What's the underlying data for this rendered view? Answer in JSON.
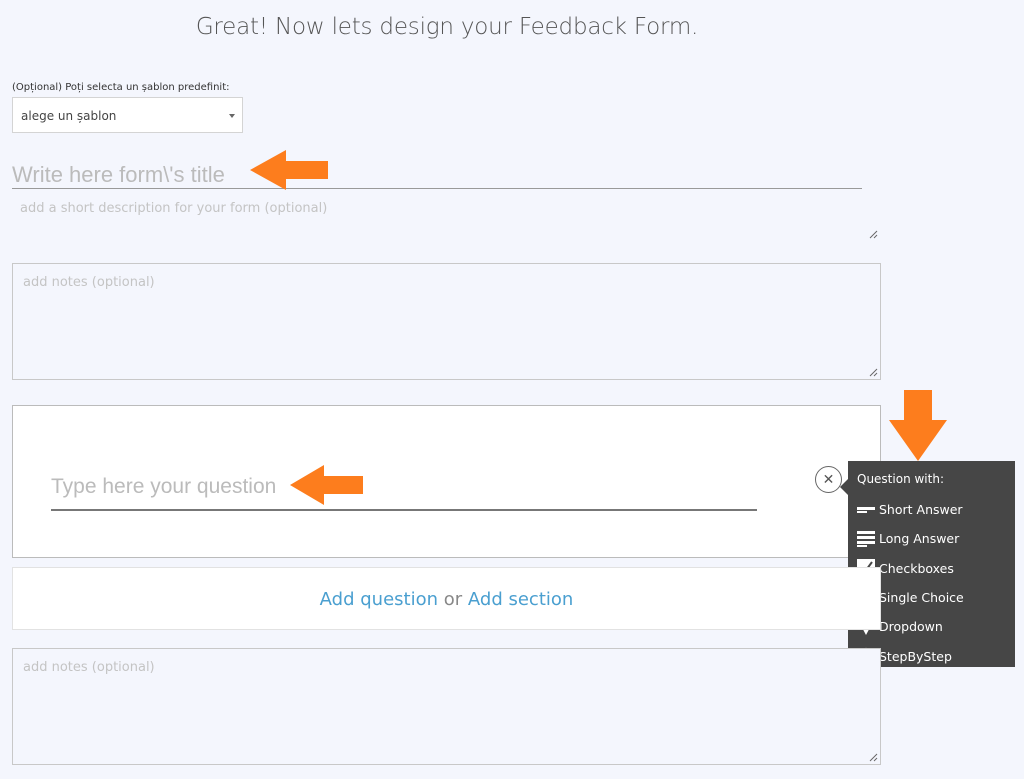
{
  "heading": "Great! Now lets design your Feedback Form.",
  "template": {
    "label": "(Opțional) Poți selecta un șablon predefinit:",
    "selected": "alege un șablon"
  },
  "form": {
    "title_placeholder": "Write here form\\'s title",
    "description_placeholder": "add a short description for your form (optional)",
    "notes_top_placeholder": "add notes (optional)",
    "notes_bottom_placeholder": "add notes (optional)"
  },
  "question": {
    "placeholder": "Type here your question",
    "close_symbol": "✕"
  },
  "add_bar": {
    "add_question": "Add question",
    "or": "or",
    "add_section": "Add section"
  },
  "question_type_menu": {
    "heading": "Question with:",
    "items": [
      {
        "label": "Short Answer",
        "icon": "short-answer-icon"
      },
      {
        "label": "Long Answer",
        "icon": "long-answer-icon"
      },
      {
        "label": "Checkboxes",
        "icon": "checkbox-icon"
      },
      {
        "label": "Single Choice",
        "icon": "radio-icon"
      },
      {
        "label": "Dropdown",
        "icon": "dropdown-triangle-icon"
      },
      {
        "label": "StepByStep",
        "icon": "star-icon"
      }
    ]
  },
  "colors": {
    "background": "#f4f6fd",
    "link": "#4a9fd0",
    "menu_bg": "#464646",
    "arrow": "#fd7d1d"
  }
}
